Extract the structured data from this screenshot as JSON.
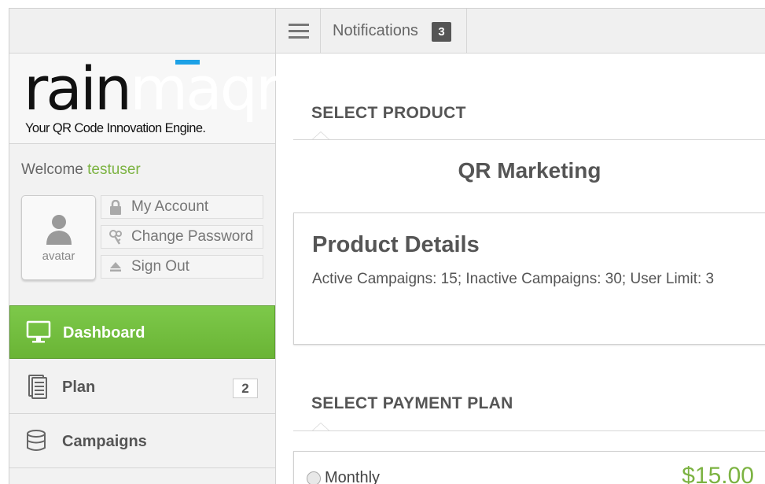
{
  "brand": {
    "logo_part1": "rain",
    "logo_part2": "maqr",
    "tagline": "Your QR Code Innovation Engine.",
    "accent_color": "#1da1e6"
  },
  "user": {
    "welcome_prefix": "Welcome",
    "username": "testuser",
    "avatar_label": "avatar"
  },
  "account_links": [
    {
      "label": "My Account",
      "icon": "lock-icon"
    },
    {
      "label": "Change Password",
      "icon": "keys-icon"
    },
    {
      "label": "Sign Out",
      "icon": "eject-icon"
    }
  ],
  "nav": [
    {
      "label": "Dashboard",
      "icon": "monitor-icon",
      "active": true
    },
    {
      "label": "Plan",
      "icon": "document-stack-icon",
      "badge": "2"
    },
    {
      "label": "Campaigns",
      "icon": "database-icon"
    }
  ],
  "topbar": {
    "notifications_label": "Notifications",
    "notifications_count": "3"
  },
  "main": {
    "select_product_heading": "SELECT PRODUCT",
    "product_name": "QR Marketing",
    "product_details_title": "Product Details",
    "product_details_text": "Active Campaigns: 15; Inactive Campaigns: 30; User Limit: 3",
    "select_payment_heading": "SELECT PAYMENT PLAN",
    "plans": [
      {
        "label": "Monthly",
        "price": "$15.00"
      }
    ]
  },
  "colors": {
    "active_nav": "#6ab435",
    "price": "#7cb342",
    "username": "#7cb342"
  }
}
